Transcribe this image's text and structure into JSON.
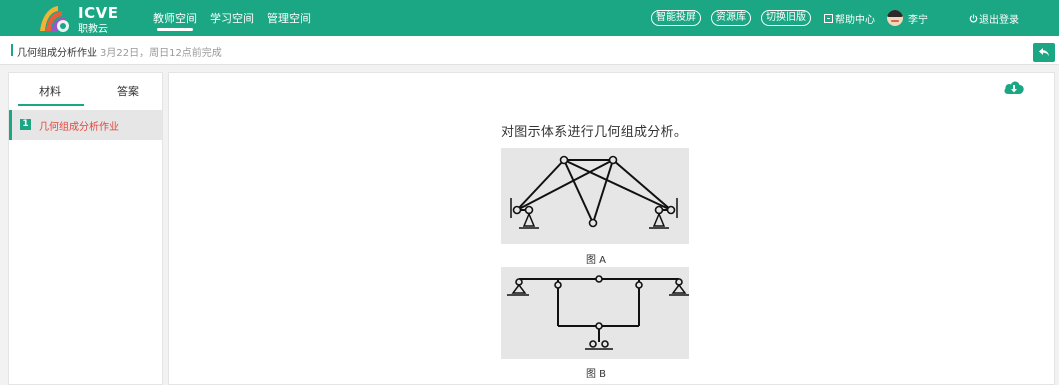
{
  "header": {
    "logo": {
      "title": "ICVE",
      "subtitle": "职教云"
    },
    "nav": [
      {
        "label": "教师空间",
        "active": true
      },
      {
        "label": "学习空间",
        "active": false
      },
      {
        "label": "管理空间",
        "active": false
      }
    ],
    "pills": [
      "智能投屏",
      "资源库",
      "切换旧版"
    ],
    "help_label": "帮助中心",
    "user_name": "李宁",
    "logout_label": "退出登录"
  },
  "subbar": {
    "title": "几何组成分析作业",
    "meta": "3月22日，周日12点前完成"
  },
  "sidebar": {
    "tabs": [
      {
        "label": "材料",
        "active": true
      },
      {
        "label": "答案",
        "active": false
      }
    ],
    "items": [
      {
        "index": "1",
        "label": "几何组成分析作业"
      }
    ]
  },
  "content": {
    "question": "对图示体系进行几何组成分析。",
    "figure_a_caption": "图 A",
    "figure_b_caption": "图 B"
  },
  "colors": {
    "brand": "#1ba784",
    "active_item_text": "#e0463e"
  },
  "icons": [
    "power-icon",
    "help-icon",
    "download-cloud-icon",
    "back-arrow-icon"
  ]
}
